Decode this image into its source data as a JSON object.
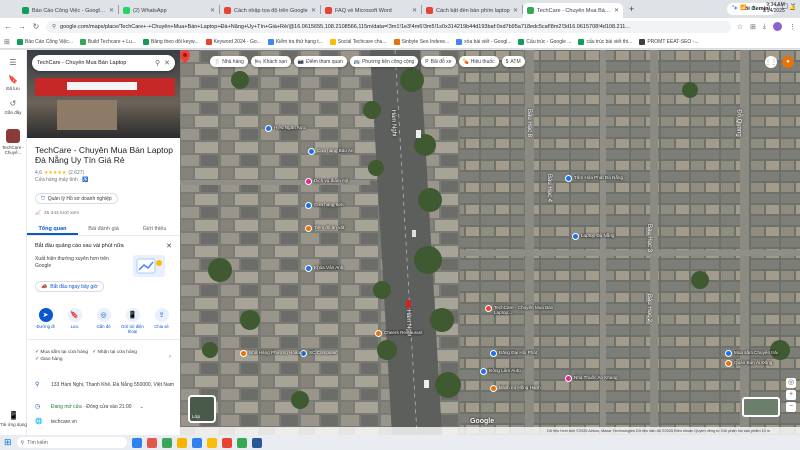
{
  "browser": {
    "tabs": [
      {
        "title": "Báo Cáo Công Việc - Google T",
        "color": "#0f9d58",
        "active": false
      },
      {
        "title": "(2) WhatsApp",
        "color": "#25d366",
        "active": false
      },
      {
        "title": "Cách nhập tọa độ trên Google",
        "color": "#ea4335",
        "active": false
      },
      {
        "title": "FAQ về Microsoft Word",
        "color": "#ea4335",
        "active": false
      },
      {
        "title": "Cách bật đèn bàn phím laptop",
        "color": "#ea4335",
        "active": false
      },
      {
        "title": "TechCare - Chuyên Mua Bán La",
        "color": "#34a853",
        "active": true
      }
    ],
    "new_tab": "+",
    "gemini_label": "Hỏi Gemini",
    "url": "google.com/maps/place/TechCare+-+Chuyên+Mua+Bán+Laptop+Đà+Nẵng+Uy+Tín+Giá+Rẻ/@16.0615655,108.2108566,115m/data=!3m1!1e3!4m6!3m5!1s0x314219b44d193baf:0xd7b95a718edc5caf!8m2!3d16.0615708!4d108.211...",
    "bookmarks": [
      {
        "label": "Báo Cáo Công Việc...",
        "color": "#0f9d58"
      },
      {
        "label": "Build Techcare + Lu...",
        "color": "#34a853"
      },
      {
        "label": "Bảng theo dõi keyw...",
        "color": "#0f9d58"
      },
      {
        "label": "Keyword 2024 - Go...",
        "color": "#ea4335"
      },
      {
        "label": "Kiểm tra thứ hạng t...",
        "color": "#4285f4"
      },
      {
        "label": "Social Techcare chu...",
        "color": "#fbbc04"
      },
      {
        "label": "Sinbyte Seo Indexe...",
        "color": "#e8710a"
      },
      {
        "label": "xóa bài viết - Googl...",
        "color": "#4285f4"
      },
      {
        "label": "Cấu trúc - Google ...",
        "color": "#0f9d58"
      },
      {
        "label": "cấu trúc bài viết thi...",
        "color": "#0f9d58"
      },
      {
        "label": "PROMT EEAT-SEO -...",
        "color": "#3c4043"
      }
    ]
  },
  "rail": {
    "items": [
      {
        "icon": "menu-icon",
        "label": ""
      },
      {
        "icon": "bookmark-icon",
        "label": "Đã lưu"
      },
      {
        "icon": "history-icon",
        "label": "Gần đây"
      },
      {
        "icon": "techcare-thumb",
        "label": "TechCare - Chuyê..."
      }
    ],
    "bottom_label": "Tải ứng dụng"
  },
  "place": {
    "search_value": "TechCare - Chuyên Mua Bán Laptop",
    "title": "TechCare - Chuyên Mua Bán Laptop Đà Nẵng Uy Tín Giá Rẻ",
    "rating": "4,6",
    "stars": "★★★★★",
    "reviews": "(2.627)",
    "category": "Cửa hàng máy tính ·",
    "claim_label": "Quản lý Hồ sơ doanh nghiệp",
    "views": "45.343 lượt xem",
    "tabs": [
      "Tổng quan",
      "Bài đánh giá",
      "Giới thiệu"
    ],
    "ad": {
      "title": "Bắt đầu quảng cáo sau vài phút nữa",
      "desc": "Xuất hiện thường xuyên hơn trên Google",
      "button": "Bắt đầu ngay bây giờ"
    },
    "actions": [
      {
        "icon": "directions-icon",
        "label": "Đường đi"
      },
      {
        "icon": "save-icon",
        "label": "Lưu"
      },
      {
        "icon": "nearby-icon",
        "label": "Gần đó"
      },
      {
        "icon": "send-to-phone-icon",
        "label": "Gửi tới điện thoại"
      },
      {
        "icon": "share-icon",
        "label": "Chia sẻ"
      }
    ],
    "features": [
      "Mua sắm tại cửa hàng",
      "Nhận tại cửa hàng",
      "Giao hàng"
    ],
    "address": "133 Hàm Nghi, Thanh Khê, Đà Nẵng 550000, Việt Nam",
    "hours_status": "Đang mở cửa",
    "hours_close": "· Đóng cửa vào 21:00",
    "website": "techcare.vn"
  },
  "map": {
    "chips": [
      {
        "icon": "🍴",
        "label": "Nhà hàng"
      },
      {
        "icon": "🛏",
        "label": "Khách sạn"
      },
      {
        "icon": "📷",
        "label": "Điểm tham quan"
      },
      {
        "icon": "🚌",
        "label": "Phương tiện công cộng"
      },
      {
        "icon": "P",
        "label": "Bãi đỗ xe"
      },
      {
        "icon": "💊",
        "label": "Hiệu thuốc"
      },
      {
        "icon": "$",
        "label": "ATM"
      }
    ],
    "streets": {
      "main": "Hàm Nghi",
      "right1": "Bàu Hạc 8",
      "right2": "Bàu Hạc 4",
      "right3": "Bàu Hạc 3",
      "right4": "Bàu Hạc 2",
      "far_right": "Đỗ Quang",
      "left": "Hàm Nghi"
    },
    "labels": [
      "Hiếu Ngân Auto",
      "Cửa hàng Bảo An",
      "Dịch vụ thẩm mỹ",
      "Cửa hàng sơn",
      "Tiệm đồ ăn vặt",
      "Khóa Vân Anh",
      "SC Computer",
      "TechCare - Chuyên Mua Bán Laptop...",
      "Cheers Restaurant",
      "Đăng Đại Hội Phát",
      "Đông Lâm Auto",
      "Tấm Hòa Phát Đà Nẵng",
      "Laptop Đà Nẵng",
      "Mua sắm Chuyển trải",
      "Bánh mì Hồng Hạnh",
      "Nhà Thuốc An Khang",
      "Quán Bún Ái Đông",
      "Nhà Hàng Phương Hoàng"
    ],
    "layers_label": "Lớp",
    "attribution": "Dữ liệu hình ảnh ©2025 Airbus, Maxar Technologies   Dữ liệu bản đồ ©2025   Điều khoản   Quyền riêng tư   Gửi phản hồi sản phẩm   10 m"
  },
  "taskbar": {
    "search_placeholder": "Tìm kiếm",
    "time": "9:34 AM",
    "date": "9/14/2025",
    "app_colors": [
      "#2f80ed",
      "#e2584b",
      "#3ba55c",
      "#f7b500",
      "#2f80ed",
      "#fbbc04",
      "#e94235",
      "#34a853",
      "#2b579a"
    ]
  }
}
